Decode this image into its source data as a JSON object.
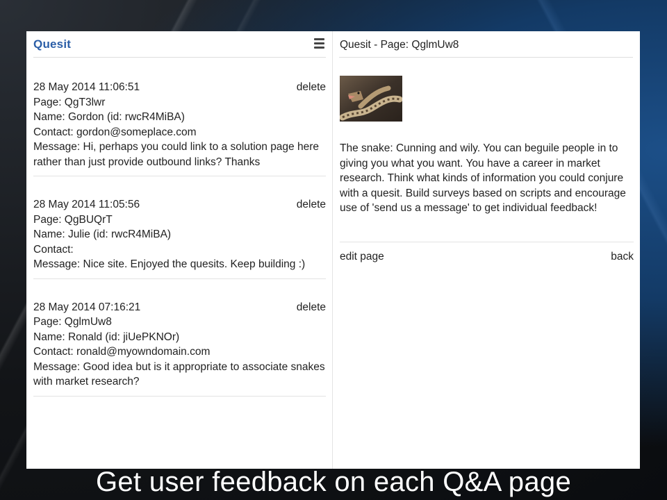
{
  "header": {
    "brand_prefix": "Q",
    "brand_rest": "uesit",
    "menu_icon": "hamburger-menu-icon"
  },
  "messages": [
    {
      "timestamp": "28 May 2014 11:06:51",
      "delete_label": "delete",
      "page": "Page: QgT3lwr",
      "name": "Name: Gordon (id: rwcR4MiBA)",
      "contact": "Contact: gordon@someplace.com",
      "message": "Message: Hi, perhaps you could link to a solution page here rather than just provide outbound links? Thanks"
    },
    {
      "timestamp": "28 May 2014 11:05:56",
      "delete_label": "delete",
      "page": "Page: QgBUQrT",
      "name": "Name: Julie (id: rwcR4MiBA)",
      "contact": "Contact:",
      "message": "Message: Nice site. Enjoyed the quesits. Keep building :)"
    },
    {
      "timestamp": "28 May 2014 07:16:21",
      "delete_label": "delete",
      "page": "Page: QglmUw8",
      "name": "Name: Ronald (id: jiUePKNOr)",
      "contact": "Contact: ronald@myowndomain.com",
      "message": "Message: Good idea but is it appropriate to associate snakes with market research?"
    }
  ],
  "page_panel": {
    "title": "Quesit - Page: QglmUw8",
    "image": "snake-photo",
    "description": "The snake: Cunning and wily. You can beguile people in to giving you what you want. You have a career in market research. Think what kinds of information you could conjure with a quesit. Build surveys based on scripts and encourage use of 'send us a message' to get individual feedback!",
    "edit_label": "edit page",
    "back_label": "back"
  },
  "caption": "Get user feedback on each Q&A page",
  "colors": {
    "brand": "#2b5ea7",
    "text": "#222222",
    "divider": "#e3e3e3"
  }
}
